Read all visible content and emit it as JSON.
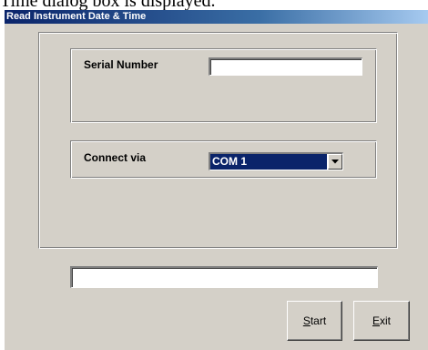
{
  "caption_fragment": "Time dialog box is displayed.",
  "window": {
    "title": "Read Instrument Date & Time"
  },
  "serial": {
    "label": "Serial Number",
    "value": ""
  },
  "connect": {
    "label": "Connect via",
    "selected": "COM 1"
  },
  "status": {
    "value": ""
  },
  "buttons": {
    "start_mnemonic": "S",
    "start_rest": "tart",
    "exit_mnemonic": "E",
    "exit_rest": "xit"
  },
  "icons": {
    "combo_arrow": "chevron-down-icon"
  }
}
